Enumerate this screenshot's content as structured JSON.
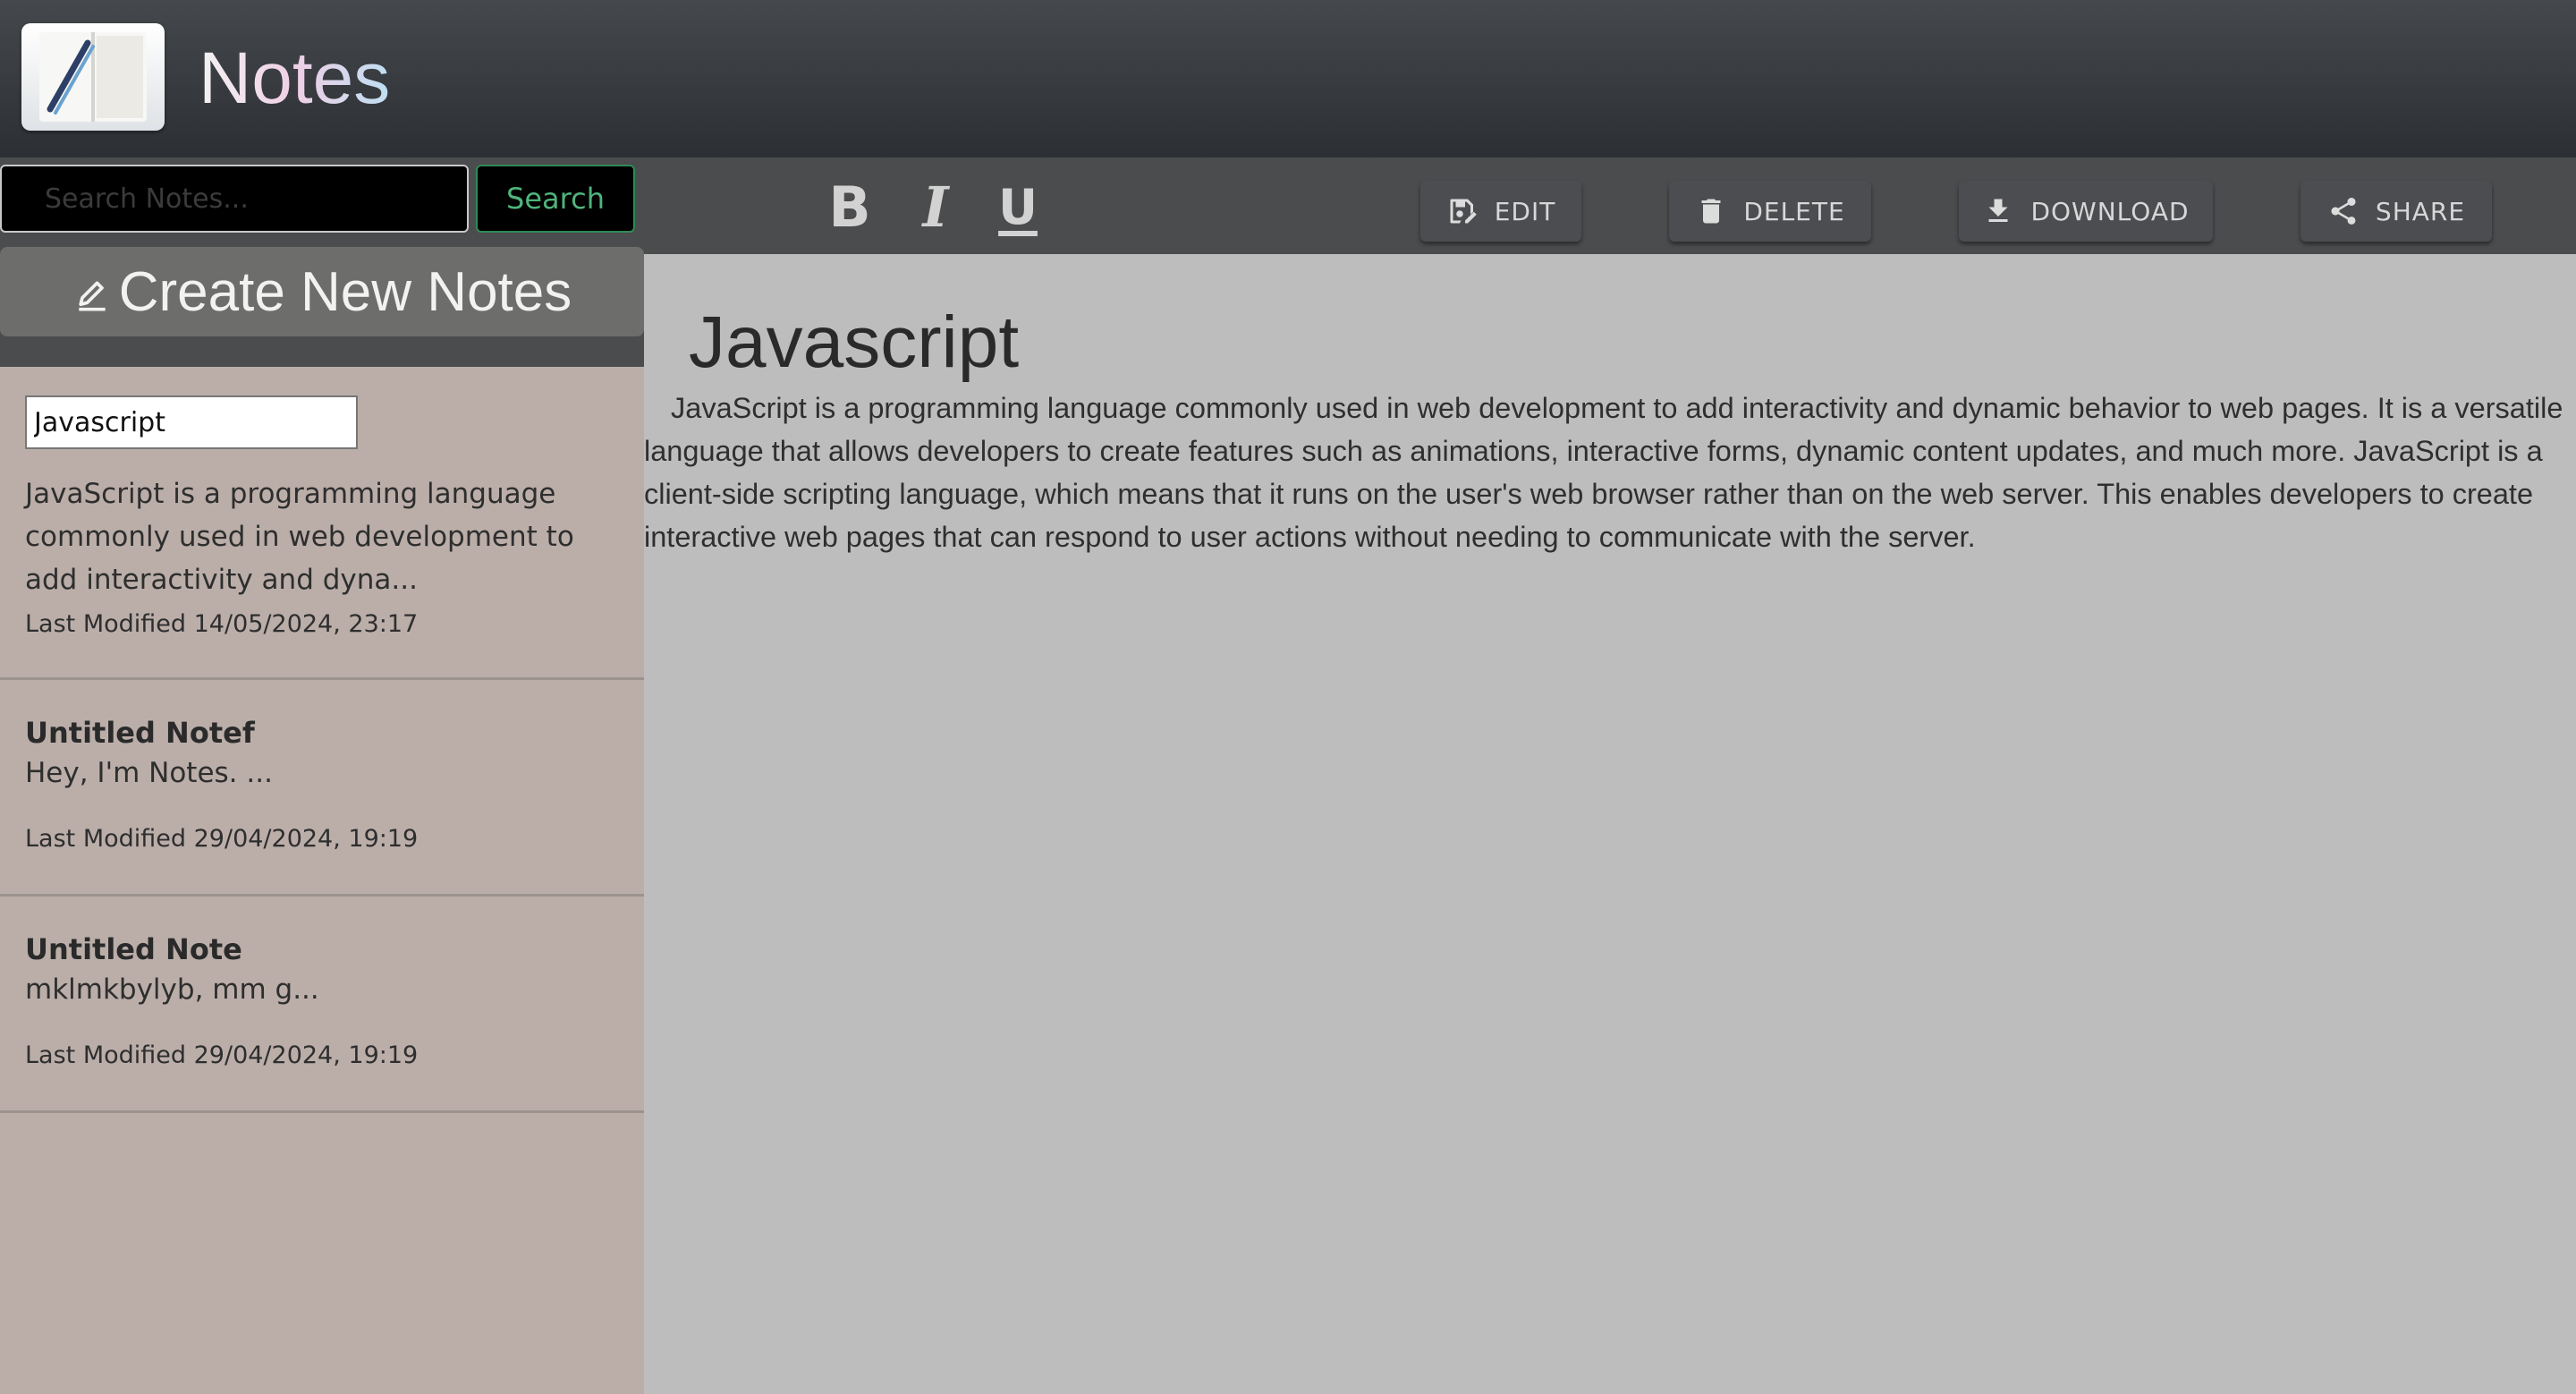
{
  "header": {
    "title": "Notes",
    "logo_icon": "notebook-pen-icon"
  },
  "search": {
    "placeholder": "Search Notes...",
    "value": "",
    "button_label": "Search"
  },
  "formatting": {
    "bold": "B",
    "italic": "I",
    "underline": "U"
  },
  "actions": {
    "edit": "EDIT",
    "delete": "DELETE",
    "download": "DOWNLOAD",
    "share": "SHARE"
  },
  "sidebar": {
    "create_label": "Create New Notes",
    "notes": [
      {
        "title": "Javascript",
        "preview": "JavaScript is a programming language commonly used in web development to add interactivity and dyna...",
        "modified": "Last Modified 14/05/2024, 23:17"
      },
      {
        "title": "Untitled Notef",
        "preview": "Hey, I'm Notes. ...",
        "modified": "Last Modified 29/04/2024, 19:19"
      },
      {
        "title": "Untitled Note",
        "preview": "mklmkbylyb, mm g...",
        "modified": "Last Modified 29/04/2024, 19:19"
      }
    ]
  },
  "note": {
    "heading": "Javascript",
    "body": "JavaScript is a programming language commonly used in web development to add interactivity and dynamic behavior to web pages. It is a versatile language that allows developers to create features such as animations, interactive forms, dynamic content updates, and much more. JavaScript is a client-side scripting language, which means that it runs on the user's web browser rather than on the web server. This enables developers to create interactive web pages that can respond to user actions without needing to communicate with the server."
  },
  "colors": {
    "header_top": "#45484c",
    "header_bottom": "#2c2f33",
    "toolbar": "#4a4c4e",
    "sidebar": "#bbaea9",
    "content": "#bdbdbd",
    "search_accent": "#4fb47c"
  }
}
